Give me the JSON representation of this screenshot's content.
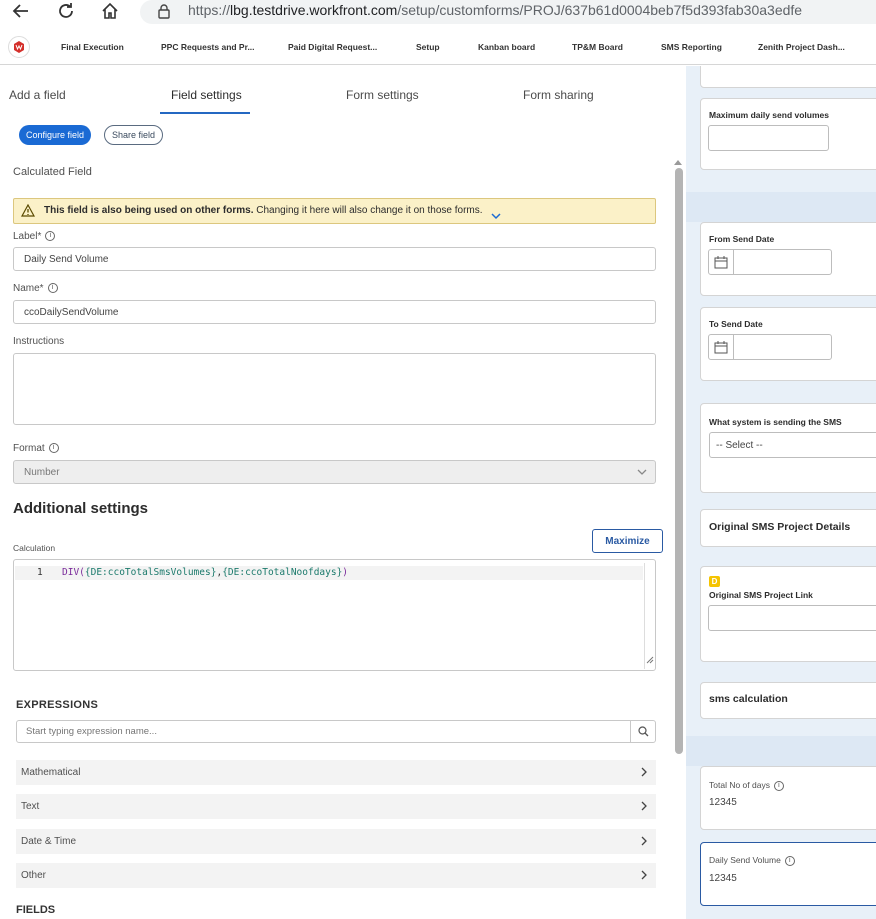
{
  "browser": {
    "url_prefix": "https://",
    "url_domain": "lbg.testdrive.workfront.com",
    "url_path": "/setup/customforms/PROJ/637b61d0004beb7f5d393fab30a3edfe"
  },
  "bookmarks": [
    "Final Execution",
    "PPC Requests and Pr...",
    "Paid Digital Request...",
    "Setup",
    "Kanban board",
    "TP&M Board",
    "SMS Reporting",
    "Zenith Project Dash..."
  ],
  "tabs": {
    "add_field": "Add a field",
    "field_settings": "Field settings",
    "form_settings": "Form settings",
    "form_sharing": "Form sharing"
  },
  "buttons": {
    "configure_field": "Configure field",
    "share_field": "Share field",
    "maximize": "Maximize"
  },
  "field_type": "Calculated Field",
  "warning": {
    "bold": "This field is also being used on other forms.",
    "text": "Changing it here will also change it on those forms."
  },
  "label_field": {
    "label": "Label*",
    "value": "Daily Send Volume"
  },
  "name_field": {
    "label": "Name*",
    "value": "ccoDailySendVolume"
  },
  "instructions": {
    "label": "Instructions",
    "value": ""
  },
  "format": {
    "label": "Format",
    "value": "Number"
  },
  "additional_settings": "Additional settings",
  "calculation": {
    "label": "Calculation",
    "line_number": "1",
    "code_fn": "DIV(",
    "code_arg1": "{DE:ccoTotalSmsVolumes}",
    "code_sep": ",",
    "code_arg2": "{DE:ccoTotalNoofdays}",
    "code_end": ")"
  },
  "expressions": {
    "heading": "EXPRESSIONS",
    "search_placeholder": "Start typing expression name...",
    "categories": [
      "Mathematical",
      "Text",
      "Date & Time",
      "Other"
    ]
  },
  "fields_heading": "FIELDS",
  "preview": {
    "max_daily_label": "Maximum daily send volumes",
    "from_send_date": "From Send Date",
    "to_send_date": "To Send Date",
    "system_label": "What system is sending the SMS",
    "select_placeholder": "-- Select --",
    "original_details": "Original SMS Project Details",
    "link_badge": "D",
    "original_link": "Original SMS Project Link",
    "sms_calculation": "sms calculation",
    "total_days_label": "Total No of days",
    "total_days_value": "12345",
    "daily_send_label": "Daily Send Volume",
    "daily_send_value": "12345"
  },
  "colors": {
    "accent": "#2468c2",
    "warning_bg": "#fbf1c8",
    "preview_bg": "#e8f0f8"
  }
}
